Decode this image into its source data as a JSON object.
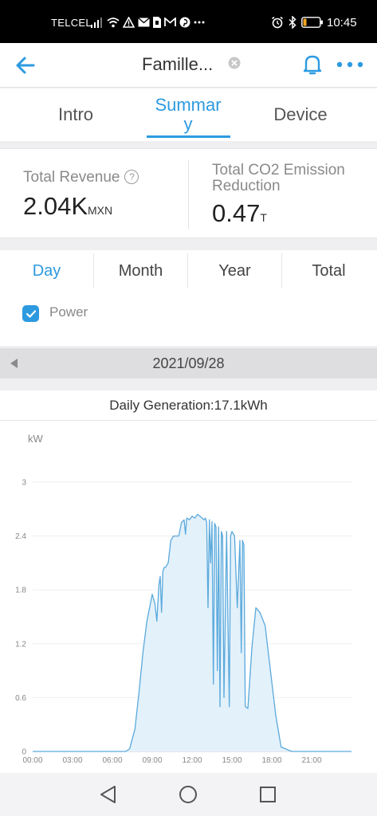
{
  "status_bar": {
    "carrier": "TELCEL",
    "time": "10:45",
    "left_icons": [
      "signal-icon",
      "wifi-icon",
      "warning-icon",
      "mail-icon",
      "sim-icon",
      "gmail-icon",
      "pinterest-icon",
      "more-dots-icon"
    ],
    "right_icons": [
      "alarm-icon",
      "bluetooth-icon",
      "battery-icon"
    ],
    "battery_level": 0.2
  },
  "header": {
    "title": "Famille...",
    "accent_color": "#2d9ae0"
  },
  "tabs": [
    {
      "label": "Intro",
      "active": false
    },
    {
      "label": "Summar\ny",
      "active": true
    },
    {
      "label": "Device",
      "active": false
    }
  ],
  "stats": {
    "revenue": {
      "label": "Total Revenue",
      "value": "2.04K",
      "unit": "MXN"
    },
    "co2": {
      "label": "Total CO2 Emission Reduction",
      "value": "0.47",
      "unit": "T"
    }
  },
  "periods": [
    {
      "label": "Day",
      "active": true
    },
    {
      "label": "Month",
      "active": false
    },
    {
      "label": "Year",
      "active": false
    },
    {
      "label": "Total",
      "active": false
    }
  ],
  "legend": {
    "label": "Power",
    "checked": true
  },
  "date": "2021/09/28",
  "daily_generation": "Daily Generation:17.1kWh",
  "chart_data": {
    "type": "area",
    "ylabel": "kW",
    "ylim": [
      0,
      3
    ],
    "y_ticks": [
      "0",
      "0.6",
      "1.2",
      "1.8",
      "2.4",
      "3"
    ],
    "x_ticks": [
      "00:00",
      "03:00",
      "06:00",
      "09:00",
      "12:00",
      "15:00",
      "18:00",
      "21:00"
    ],
    "xlim_hours": [
      0,
      24
    ],
    "grid": true,
    "line_color": "#5aa9dc",
    "fill_color": "#e3f1fb",
    "series": [
      {
        "x": [
          0,
          7.0,
          7.3,
          7.7,
          8.0,
          8.3,
          8.6,
          9.0,
          9.2,
          9.35,
          9.5,
          9.6,
          9.7,
          9.8,
          9.9,
          10.0,
          10.2,
          10.4,
          10.6,
          10.8,
          11.0,
          11.2,
          11.4,
          11.5,
          11.6,
          11.8,
          12.0,
          12.2,
          12.4,
          12.6,
          12.9,
          13.0,
          13.1,
          13.2,
          13.3,
          13.4,
          13.5,
          13.6,
          13.7,
          13.8,
          13.9,
          14.0,
          14.1,
          14.2,
          14.3,
          14.4,
          14.6,
          14.8,
          14.9,
          15.0,
          15.2,
          15.4,
          15.6,
          15.7,
          15.8,
          15.9,
          16.0,
          16.2,
          16.5,
          16.8,
          17.1,
          17.5,
          17.9,
          18.3,
          18.7,
          19.5,
          24
        ],
        "y": [
          0,
          0,
          0.03,
          0.25,
          0.65,
          1.1,
          1.45,
          1.75,
          1.65,
          1.45,
          1.85,
          1.95,
          1.55,
          2.0,
          2.05,
          2.05,
          2.1,
          2.35,
          2.4,
          2.4,
          2.4,
          2.55,
          2.58,
          2.42,
          2.6,
          2.58,
          2.62,
          2.6,
          2.64,
          2.62,
          2.58,
          2.6,
          2.55,
          1.6,
          2.58,
          2.1,
          2.56,
          0.75,
          2.54,
          2.5,
          0.9,
          2.5,
          0.5,
          2.45,
          2.4,
          0.6,
          2.45,
          0.5,
          2.4,
          2.45,
          2.4,
          1.6,
          2.35,
          1.1,
          2.35,
          2.3,
          0.5,
          0.48,
          1.15,
          1.6,
          1.55,
          1.4,
          0.9,
          0.4,
          0.05,
          0,
          0
        ]
      }
    ]
  }
}
